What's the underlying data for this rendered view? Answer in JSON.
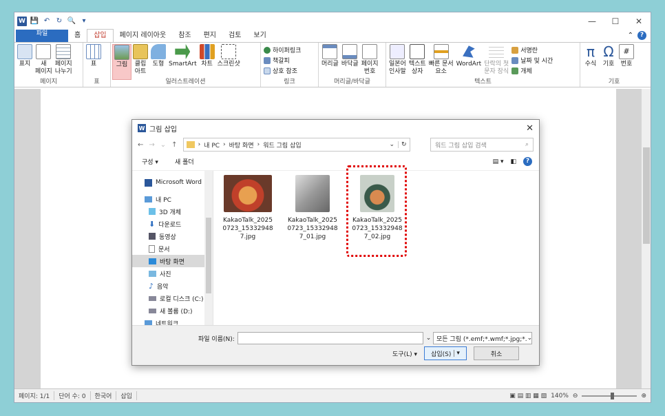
{
  "window": {
    "minimize": "—",
    "maximize": "☐",
    "close": "✕"
  },
  "tabs": {
    "file": "파일",
    "items": [
      "홈",
      "삽입",
      "페이지 레이아웃",
      "참조",
      "편지",
      "검토",
      "보기"
    ],
    "active": "삽입"
  },
  "ribbon": {
    "page_group": {
      "label": "페이지",
      "buttons": [
        "표지",
        "새\n페이지",
        "페이지\n나누기"
      ]
    },
    "table_group": {
      "label": "표",
      "buttons": [
        "표"
      ]
    },
    "illus_group": {
      "label": "일러스트레이션",
      "buttons": [
        "그림",
        "클립\n아트",
        "도형",
        "SmartArt",
        "차트",
        "스크린샷"
      ]
    },
    "link_group": {
      "label": "링크",
      "items": [
        "하이퍼링크",
        "책갈피",
        "상호 참조"
      ]
    },
    "hf_group": {
      "label": "머리글/바닥글",
      "buttons": [
        "머리글",
        "바닥글",
        "페이지\n번호"
      ]
    },
    "text_group": {
      "label": "텍스트",
      "buttons": [
        "일본어\n인사말",
        "텍스트\n상자",
        "빠른 문서\n요소",
        "WordArt",
        "단락의 첫\n문자 장식"
      ],
      "small": [
        "서명란",
        "날짜 및 시간",
        "개체"
      ]
    },
    "sym_group": {
      "label": "기호",
      "buttons": [
        "수식",
        "기호",
        "번호"
      ]
    }
  },
  "status": {
    "page": "페이지: 1/1",
    "words": "단어 수: 0",
    "lang": "한국어",
    "mode": "삽입",
    "zoom": "140%",
    "zoom_level": 0.55
  },
  "dialog": {
    "title": "그림 삽입",
    "path": [
      "내 PC",
      "바탕 화면",
      "워드 그림 삽입"
    ],
    "search_placeholder": "워드 그림 삽입 검색",
    "organize": "구성 ▾",
    "new_folder": "새 폴더",
    "nav": [
      "Microsoft Word",
      "내 PC",
      "3D 개체",
      "다운로드",
      "동영상",
      "문서",
      "바탕 화면",
      "사진",
      "음악",
      "로컬 디스크 (C:)",
      "새 볼륨 (D:)",
      "네트워크"
    ],
    "files": [
      {
        "name": "KakaoTalk_20250723_153329487.jpg"
      },
      {
        "name": "KakaoTalk_20250723_153329487_01.jpg"
      },
      {
        "name": "KakaoTalk_20250723_153329487_02.jpg"
      }
    ],
    "filename_label": "파일 이름(N):",
    "filetype": "모든 그림 (*.emf;*.wmf;*.jpg;*.",
    "tools": "도구(L)",
    "insert": "삽입(S)",
    "cancel": "취소"
  }
}
